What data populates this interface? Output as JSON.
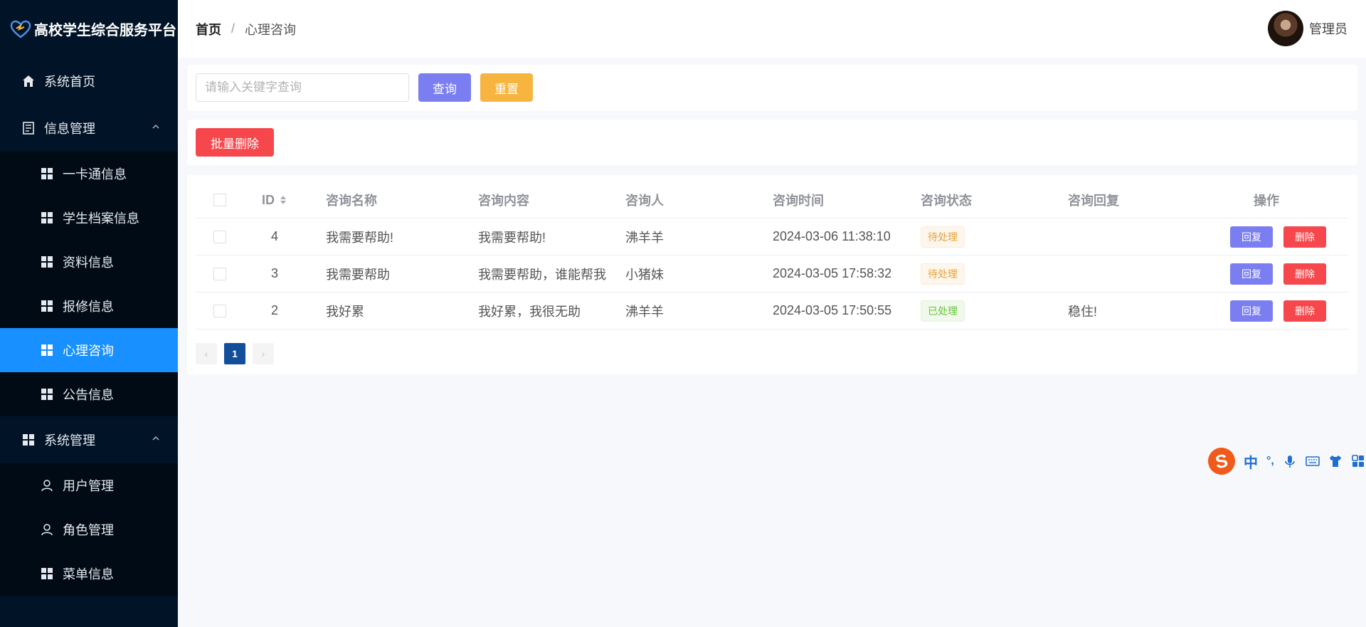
{
  "app": {
    "title": "高校学生综合服务平台"
  },
  "sidebar": {
    "home": "系统首页",
    "info_group": "信息管理",
    "info_items": [
      "一卡通信息",
      "学生档案信息",
      "资料信息",
      "报修信息",
      "心理咨询",
      "公告信息"
    ],
    "system_group": "系统管理",
    "system_items": [
      "用户管理",
      "角色管理",
      "菜单信息"
    ],
    "active_item": "心理咨询"
  },
  "header": {
    "breadcrumb_home": "首页",
    "breadcrumb_sep": "/",
    "breadcrumb_current": "心理咨询",
    "user_name": "管理员"
  },
  "search": {
    "placeholder": "请输入关键字查询",
    "query_label": "查询",
    "reset_label": "重置"
  },
  "actions": {
    "batch_delete_label": "批量删除"
  },
  "table": {
    "headers": {
      "id": "ID",
      "name": "咨询名称",
      "content": "咨询内容",
      "person": "咨询人",
      "time": "咨询时间",
      "status": "咨询状态",
      "reply": "咨询回复",
      "ops": "操作"
    },
    "rows": [
      {
        "id": "4",
        "name": "我需要帮助!",
        "content": "我需要帮助!",
        "person": "沸羊羊",
        "time": "2024-03-06 11:38:10",
        "status": "待处理",
        "reply": ""
      },
      {
        "id": "3",
        "name": "我需要帮助",
        "content": "我需要帮助，谁能帮我",
        "person": "小猪妹",
        "time": "2024-03-05 17:58:32",
        "status": "待处理",
        "reply": ""
      },
      {
        "id": "2",
        "name": "我好累",
        "content": "我好累，我很无助",
        "person": "沸羊羊",
        "time": "2024-03-05 17:50:55",
        "status": "已处理",
        "reply": "稳住!"
      }
    ],
    "reply_btn": "回复",
    "delete_btn": "删除"
  },
  "pagination": {
    "prev": "‹",
    "current": "1",
    "next": "›"
  },
  "ime": {
    "logo": "S",
    "lang": "中",
    "punct": "°,",
    "icons": [
      "microphone-icon",
      "keyboard-icon",
      "shirt-icon",
      "apps-icon"
    ]
  },
  "colors": {
    "sidebar_bg": "#011427",
    "active": "#1890ff",
    "primary_btn": "#7b7ef0",
    "warning_btn": "#f7b53f",
    "danger_btn": "#f5474c",
    "pending_tag": "#e6a23c",
    "done_tag": "#67c23a"
  }
}
